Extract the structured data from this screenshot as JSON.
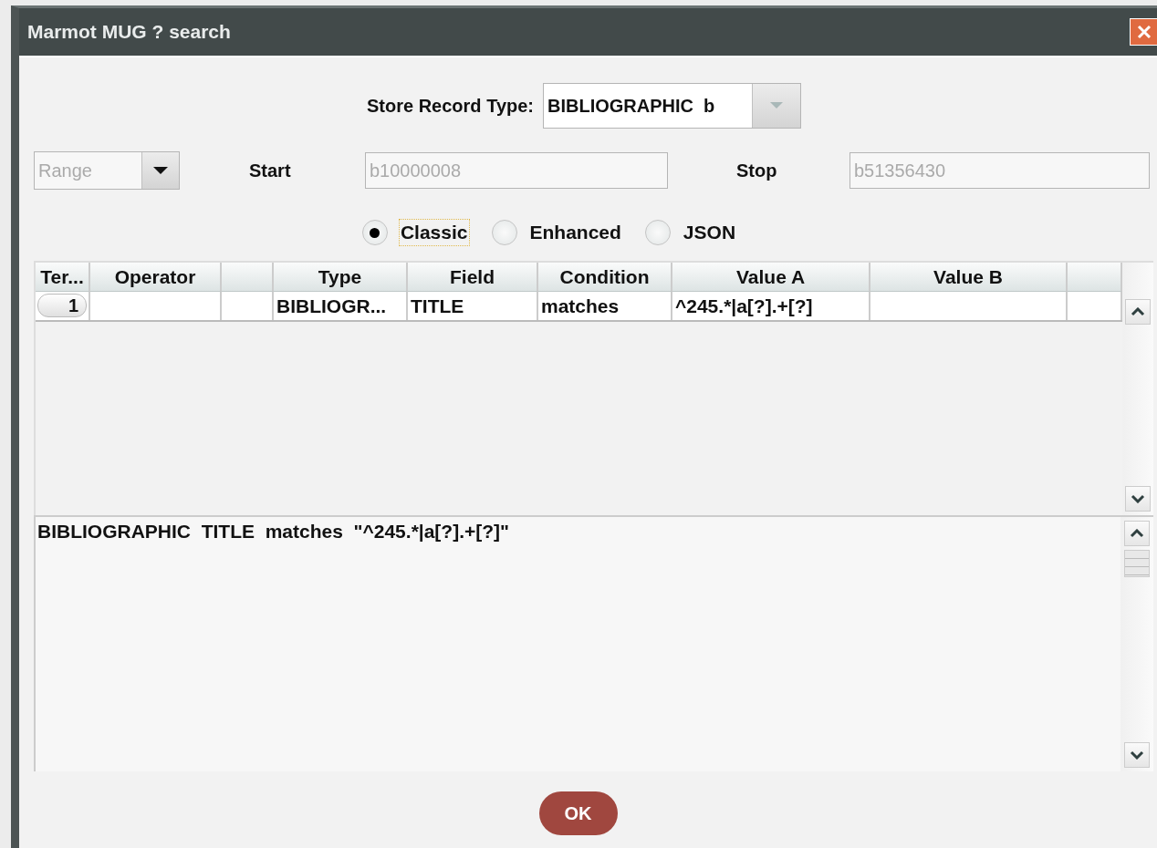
{
  "window": {
    "title": "Marmot MUG ? search"
  },
  "store_record_type": {
    "label": "Store Record Type:",
    "value": "BIBLIOGRAPHIC  b"
  },
  "range": {
    "value": "Range",
    "disabled": true
  },
  "start": {
    "label": "Start",
    "value": "b10000008",
    "disabled": true
  },
  "stop": {
    "label": "Stop",
    "value": "b51356430",
    "disabled": true
  },
  "formats": [
    {
      "label": "Classic",
      "selected": true
    },
    {
      "label": "Enhanced",
      "selected": false
    },
    {
      "label": "JSON",
      "selected": false
    }
  ],
  "table": {
    "columns": [
      {
        "kind": "text",
        "label": "Ter..."
      },
      {
        "kind": "text",
        "label": "Operator"
      },
      {
        "kind": "blank"
      },
      {
        "kind": "text",
        "label": "Type"
      },
      {
        "kind": "text",
        "label": "Field"
      },
      {
        "kind": "text",
        "label": "Condition"
      },
      {
        "kind": "text",
        "label": "Value A"
      },
      {
        "kind": "text",
        "label": "Value B"
      },
      {
        "kind": "blank"
      }
    ],
    "rows": [
      {
        "cells": [
          {
            "kind": "button",
            "text": "1"
          },
          {
            "kind": "empty"
          },
          {
            "kind": "empty"
          },
          {
            "kind": "text",
            "text": "BIBLIOGR..."
          },
          {
            "kind": "text",
            "text": "TITLE"
          },
          {
            "kind": "text",
            "text": "matches"
          },
          {
            "kind": "text",
            "text": "^245.*|a[?].+[?]"
          },
          {
            "kind": "empty"
          },
          {
            "kind": "empty"
          }
        ]
      }
    ]
  },
  "expression": "BIBLIOGRAPHIC  TITLE  matches  \"^245.*|a[?].+[?]\"",
  "buttons": [
    {
      "label": "OK"
    }
  ]
}
